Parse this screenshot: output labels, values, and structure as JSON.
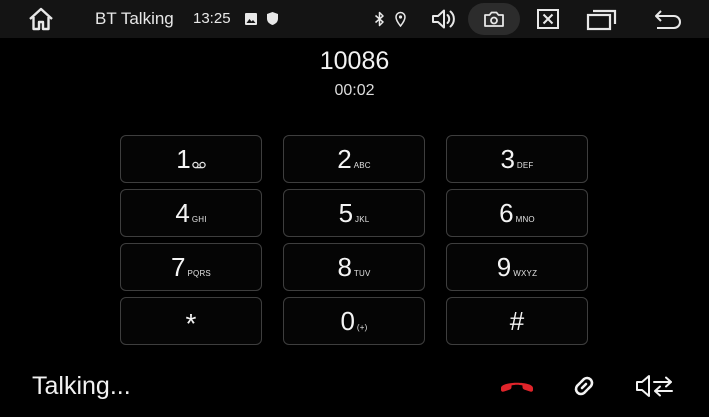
{
  "status_bar": {
    "title": "BT Talking",
    "time": "13:25",
    "icons": [
      "home-icon",
      "gallery-icon",
      "shield-icon",
      "bluetooth-icon",
      "location-icon",
      "volume-icon",
      "screenshot-camera-icon",
      "close-box-icon",
      "windows-icon",
      "back-icon"
    ]
  },
  "call": {
    "number": "10086",
    "duration": "00:02"
  },
  "keypad": {
    "keys": [
      {
        "digit": "1",
        "letters": "",
        "sub_icon": "voicemail-icon"
      },
      {
        "digit": "2",
        "letters": "ABC"
      },
      {
        "digit": "3",
        "letters": "DEF"
      },
      {
        "digit": "4",
        "letters": "GHI"
      },
      {
        "digit": "5",
        "letters": "JKL"
      },
      {
        "digit": "6",
        "letters": "MNO"
      },
      {
        "digit": "7",
        "letters": "PQRS"
      },
      {
        "digit": "8",
        "letters": "TUV"
      },
      {
        "digit": "9",
        "letters": "WXYZ"
      },
      {
        "digit": "*",
        "letters": ""
      },
      {
        "digit": "0",
        "letters": "(+)"
      },
      {
        "digit": "#",
        "letters": ""
      }
    ]
  },
  "footer": {
    "status": "Talking...",
    "icons": [
      "hang-up-icon",
      "link-icon",
      "audio-switch-icon"
    ]
  },
  "colors": {
    "background": "#000000",
    "status_bar": "#141414",
    "key_border": "#3e3e3e",
    "hangup_red": "#e0242a",
    "text": "#f2f2f2"
  }
}
